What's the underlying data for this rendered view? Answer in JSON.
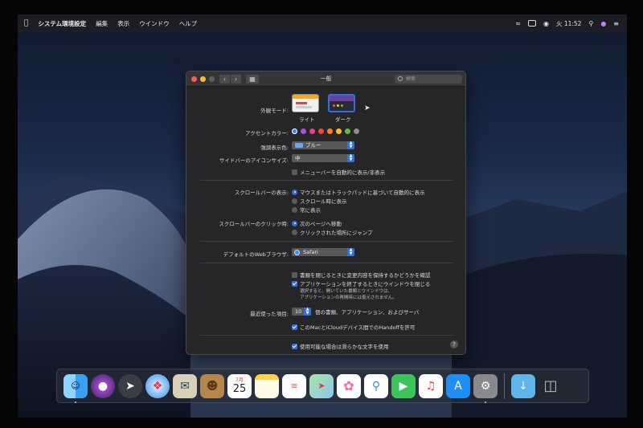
{
  "menubar": {
    "app": "システム環境設定",
    "items": [
      "編集",
      "表示",
      "ウインドウ",
      "ヘルプ"
    ],
    "clock": "火 11:52"
  },
  "window": {
    "title": "一般",
    "search_placeholder": "検索"
  },
  "appearance": {
    "label": "外観モード:",
    "options": [
      "ライト",
      "ダーク"
    ],
    "selected": "ダーク"
  },
  "accent": {
    "label": "アクセントカラー:",
    "colors": [
      "#3a82f7",
      "#b24fd4",
      "#e8428f",
      "#f2453d",
      "#f7821b",
      "#fbc02d",
      "#62ba46",
      "#8c8c8c"
    ]
  },
  "highlight": {
    "label": "強調表示色:",
    "value": "ブルー"
  },
  "sidebar_icon": {
    "label": "サイドバーのアイコンサイズ:",
    "value": "中"
  },
  "menubar_auto": {
    "label": "メニューバーを自動的に表示/非表示",
    "checked": false
  },
  "scrollbars_show": {
    "label": "スクロールバーの表示:",
    "options": [
      "マウスまたはトラックパッドに基づいて自動的に表示",
      "スクロール時に表示",
      "常に表示"
    ],
    "selected": 0
  },
  "scrollbar_click": {
    "label": "スクロールバーのクリック時:",
    "options": [
      "次のページへ移動",
      "クリックされた場所にジャンプ"
    ],
    "selected": 0
  },
  "browser": {
    "label": "デフォルトのWebブラウザ:",
    "value": "Safari"
  },
  "close_docs": {
    "label": "書類を閉じるときに変更内容を保持するかどうかを確認",
    "checked": false
  },
  "close_windows": {
    "label": "アプリケーションを終了するときにウインドウを閉じる",
    "checked": true
  },
  "close_windows_note": {
    "line1": "選択すると、開いていた書類とウインドウは、",
    "line2": "アプリケーションの再開時には復元されません。"
  },
  "recent": {
    "label": "最近使った項目:",
    "value": "10",
    "suffix": "個の書類、アプリケーション、およびサーバ"
  },
  "handoff": {
    "label": "このMacとiCloudデバイス間でのHandoffを許可",
    "checked": true
  },
  "font_smoothing": {
    "label": "使用可能な場合は滑らかな文字を使用",
    "checked": true
  },
  "dock": {
    "calendar_month": "7月",
    "calendar_day": "25"
  }
}
